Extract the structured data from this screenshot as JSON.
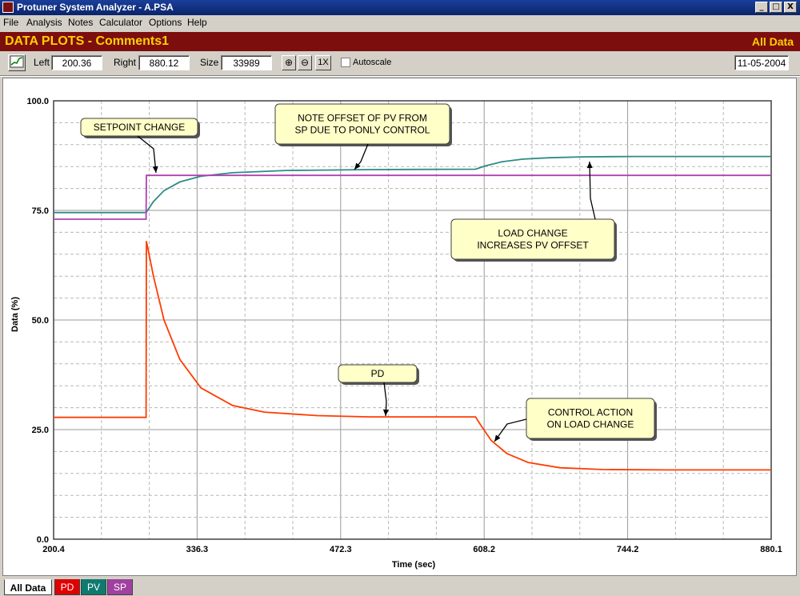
{
  "window": {
    "title": "Protuner System Analyzer - A.PSA",
    "btn_min": "_",
    "btn_max": "□",
    "btn_close": "X"
  },
  "menu": [
    "File",
    "Analysis",
    "Notes",
    "Calculator",
    "Options",
    "Help"
  ],
  "banner": {
    "title": "DATA PLOTS - Comments1",
    "mode": "All Data"
  },
  "toolbar": {
    "left_label": "Left",
    "left_value": "200.36",
    "right_label": "Right",
    "right_value": "880.12",
    "size_label": "Size",
    "size_value": "33989",
    "zoom_in": "⊕",
    "zoom_out": "⊖",
    "zoom_1x": "1X",
    "autoscale_label": "Autoscale",
    "autoscale_checked": false,
    "date": "11-05-2004"
  },
  "tabs": [
    {
      "label": "All Data",
      "bg": "#d4d0c8",
      "fg": "#000000",
      "active": true
    },
    {
      "label": "PD",
      "bg": "#e00000",
      "fg": "#ffffff"
    },
    {
      "label": "PV",
      "bg": "#0f7a70",
      "fg": "#ffffff"
    },
    {
      "label": "SP",
      "bg": "#a040a0",
      "fg": "#ffffff"
    }
  ],
  "chart_data": {
    "type": "line",
    "xlabel": "Time (sec)",
    "ylabel": "Data (%)",
    "xlim": [
      200.4,
      880.1
    ],
    "ylim": [
      0.0,
      100.0
    ],
    "x_ticks": [
      "200.4",
      "336.3",
      "472.3",
      "608.2",
      "744.2",
      "880.1"
    ],
    "y_ticks": [
      "0.0",
      "25.0",
      "50.0",
      "75.0",
      "100.0"
    ],
    "grid": true,
    "series": [
      {
        "name": "PD",
        "color": "#ff3c00",
        "x": [
          200.4,
          288,
          288.3,
          295,
          305,
          320,
          340,
          370,
          400,
          450,
          500,
          600,
          605,
          615,
          630,
          650,
          680,
          720,
          780,
          880.1
        ],
        "y": [
          27.8,
          27.8,
          68,
          60,
          50,
          41,
          34.5,
          30.5,
          29,
          28.2,
          27.9,
          27.9,
          26,
          22.5,
          19.5,
          17.5,
          16.3,
          15.9,
          15.8,
          15.8
        ]
      },
      {
        "name": "PV",
        "color": "#2e8b86",
        "x": [
          200.4,
          288,
          295,
          305,
          320,
          340,
          370,
          420,
          500,
          600,
          610,
          625,
          645,
          670,
          700,
          750,
          880.1
        ],
        "y": [
          74.5,
          74.5,
          77,
          79.5,
          81.5,
          82.8,
          83.6,
          84.1,
          84.3,
          84.4,
          85.2,
          86.1,
          86.7,
          87.0,
          87.2,
          87.3,
          87.3
        ]
      },
      {
        "name": "SP",
        "color": "#b040b0",
        "x": [
          200.4,
          288,
          288.3,
          880.1
        ],
        "y": [
          73,
          73,
          83,
          83
        ]
      }
    ],
    "annotations": [
      {
        "lines": [
          "SETPOINT CHANGE"
        ]
      },
      {
        "lines": [
          "NOTE OFFSET OF PV FROM",
          "SP DUE TO PONLY CONTROL"
        ]
      },
      {
        "lines": [
          "LOAD CHANGE",
          "INCREASES PV OFFSET"
        ]
      },
      {
        "lines": [
          "PD"
        ]
      },
      {
        "lines": [
          "CONTROL ACTION",
          "ON  LOAD CHANGE"
        ]
      }
    ]
  }
}
